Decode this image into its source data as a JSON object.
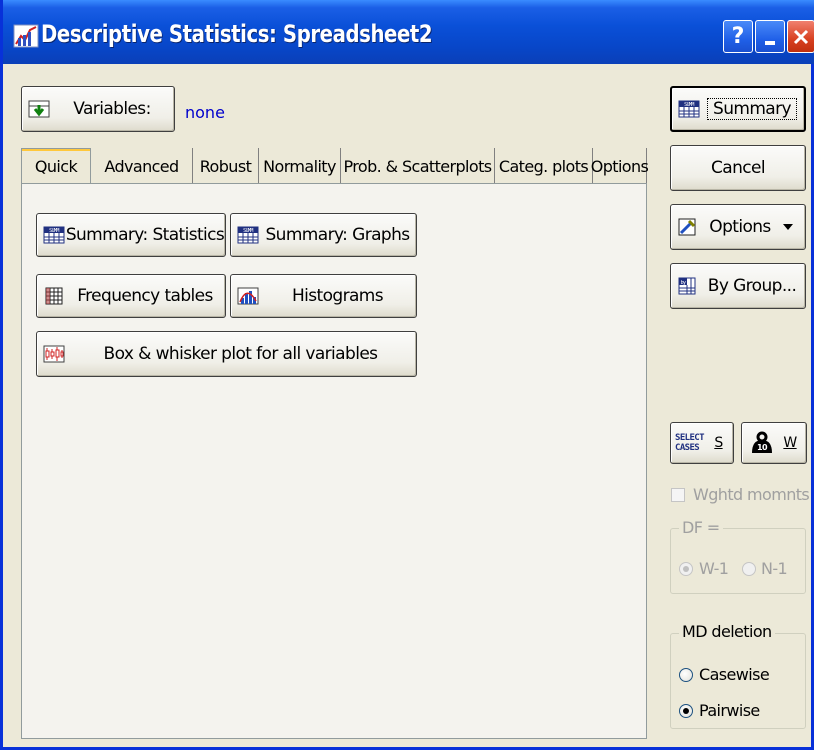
{
  "window": {
    "title": "Descriptive Statistics: Spreadsheet2",
    "help_label": "?"
  },
  "variables": {
    "button_label": "Variables:",
    "value": "none"
  },
  "tabs": [
    {
      "label": "Quick"
    },
    {
      "label": "Advanced"
    },
    {
      "label": "Robust"
    },
    {
      "label": "Normality"
    },
    {
      "label": "Prob. & Scatterplots"
    },
    {
      "label": "Categ. plots"
    },
    {
      "label": "Options"
    }
  ],
  "quick": {
    "summary_statistics": "Summary: Statistics",
    "summary_graphs": "Summary: Graphs",
    "frequency_tables": "Frequency tables",
    "histograms": "Histograms",
    "box_whisker": "Box & whisker plot for all variables"
  },
  "right_panel": {
    "summary": "Summary",
    "cancel": "Cancel",
    "options": "Options",
    "by_group": "By Group...",
    "select_cases_icon_line1": "SELECT",
    "select_cases_icon_line2": "CASES",
    "select_cases_key": "S",
    "weight_key": "W",
    "weighted_moments": "Wghtd momnts",
    "df_group": "DF =",
    "df_w1": "W-1",
    "df_n1": "N-1",
    "md_group": "MD deletion",
    "casewise": "Casewise",
    "pairwise": "Pairwise"
  },
  "colors": {
    "titlebar": "#0A50D8",
    "variables_value": "#0000CC",
    "dialog_bg": "#ECE9D8"
  }
}
